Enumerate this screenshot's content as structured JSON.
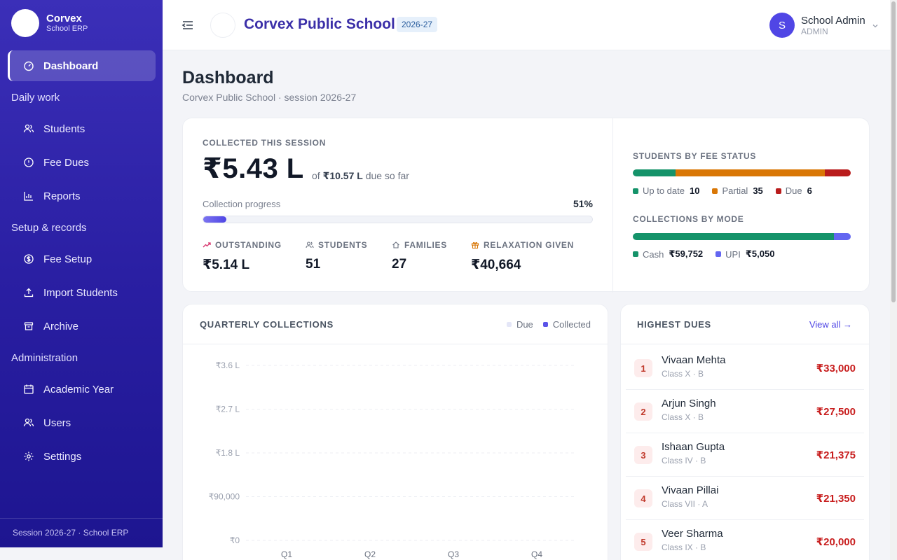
{
  "brand": {
    "name": "Corvex",
    "sub": "School ERP"
  },
  "sidebar": {
    "dashboard": "Dashboard",
    "sections": {
      "daily": "Daily work",
      "setup": "Setup & records",
      "admin": "Administration"
    },
    "items": {
      "students": "Students",
      "fee_dues": "Fee Dues",
      "reports": "Reports",
      "fee_setup": "Fee Setup",
      "import_students": "Import Students",
      "archive": "Archive",
      "academic_year": "Academic Year",
      "users": "Users",
      "settings": "Settings"
    },
    "footer": "Session 2026-27 · School ERP"
  },
  "topbar": {
    "school_name": "Corvex Public School",
    "session_badge": "2026-27",
    "user_initial": "S",
    "user_name": "School Admin",
    "user_role": "ADMIN"
  },
  "page": {
    "title": "Dashboard",
    "subtitle": "Corvex Public School · session 2026-27"
  },
  "summary": {
    "collected_label": "COLLECTED THIS SESSION",
    "collected_amount": "₹5.43 L",
    "due_prefix": "of",
    "due_amount": "₹10.57 L",
    "due_suffix": "due so far",
    "progress_label": "Collection progress",
    "progress_pct_text": "51%",
    "progress_fraction": 0.06,
    "stats": {
      "outstanding_label": "OUTSTANDING",
      "outstanding_value": "₹5.14 L",
      "students_label": "STUDENTS",
      "students_value": "51",
      "families_label": "FAMILIES",
      "families_value": "27",
      "relaxation_label": "RELAXATION GIVEN",
      "relaxation_value": "₹40,664"
    },
    "fee_status": {
      "label": "STUDENTS BY FEE STATUS",
      "up_to_date_label": "Up to date",
      "up_to_date_value": "10",
      "partial_label": "Partial",
      "partial_value": "35",
      "due_label": "Due",
      "due_value": "6",
      "colors": {
        "up_to_date": "#15936a",
        "partial": "#d97706",
        "due": "#b91c1c"
      }
    },
    "modes": {
      "label": "COLLECTIONS BY MODE",
      "cash_label": "Cash",
      "cash_value": "₹59,752",
      "upi_label": "UPI",
      "upi_value": "₹5,050",
      "cash_amount": 59752,
      "upi_amount": 5050,
      "colors": {
        "cash": "#15936a",
        "upi": "#6366f1"
      }
    }
  },
  "chart_data": {
    "type": "bar",
    "title": "QUARTERLY COLLECTIONS",
    "categories": [
      "Q1",
      "Q2",
      "Q3",
      "Q4"
    ],
    "y_ticks": [
      "₹0",
      "₹90,000",
      "₹1.8 L",
      "₹2.7 L",
      "₹3.6 L"
    ],
    "ylim": [
      0,
      360000
    ],
    "legend_placement": "top-right",
    "grid": true,
    "series": [
      {
        "name": "Due",
        "color": "#e4e6f7",
        "values": [
          0,
          0,
          0,
          0
        ]
      },
      {
        "name": "Collected",
        "color": "#5b54e8",
        "values": [
          0,
          0,
          0,
          0
        ]
      }
    ]
  },
  "dues": {
    "title": "HIGHEST DUES",
    "view_all": "View all →",
    "rows": [
      {
        "rank": "1",
        "name": "Vivaan Mehta",
        "class": "Class X · B",
        "amount": "₹33,000"
      },
      {
        "rank": "2",
        "name": "Arjun Singh",
        "class": "Class X · B",
        "amount": "₹27,500"
      },
      {
        "rank": "3",
        "name": "Ishaan Gupta",
        "class": "Class IV · B",
        "amount": "₹21,375"
      },
      {
        "rank": "4",
        "name": "Vivaan Pillai",
        "class": "Class VII · A",
        "amount": "₹21,350"
      },
      {
        "rank": "5",
        "name": "Veer Sharma",
        "class": "Class IX · B",
        "amount": "₹20,000"
      }
    ]
  }
}
